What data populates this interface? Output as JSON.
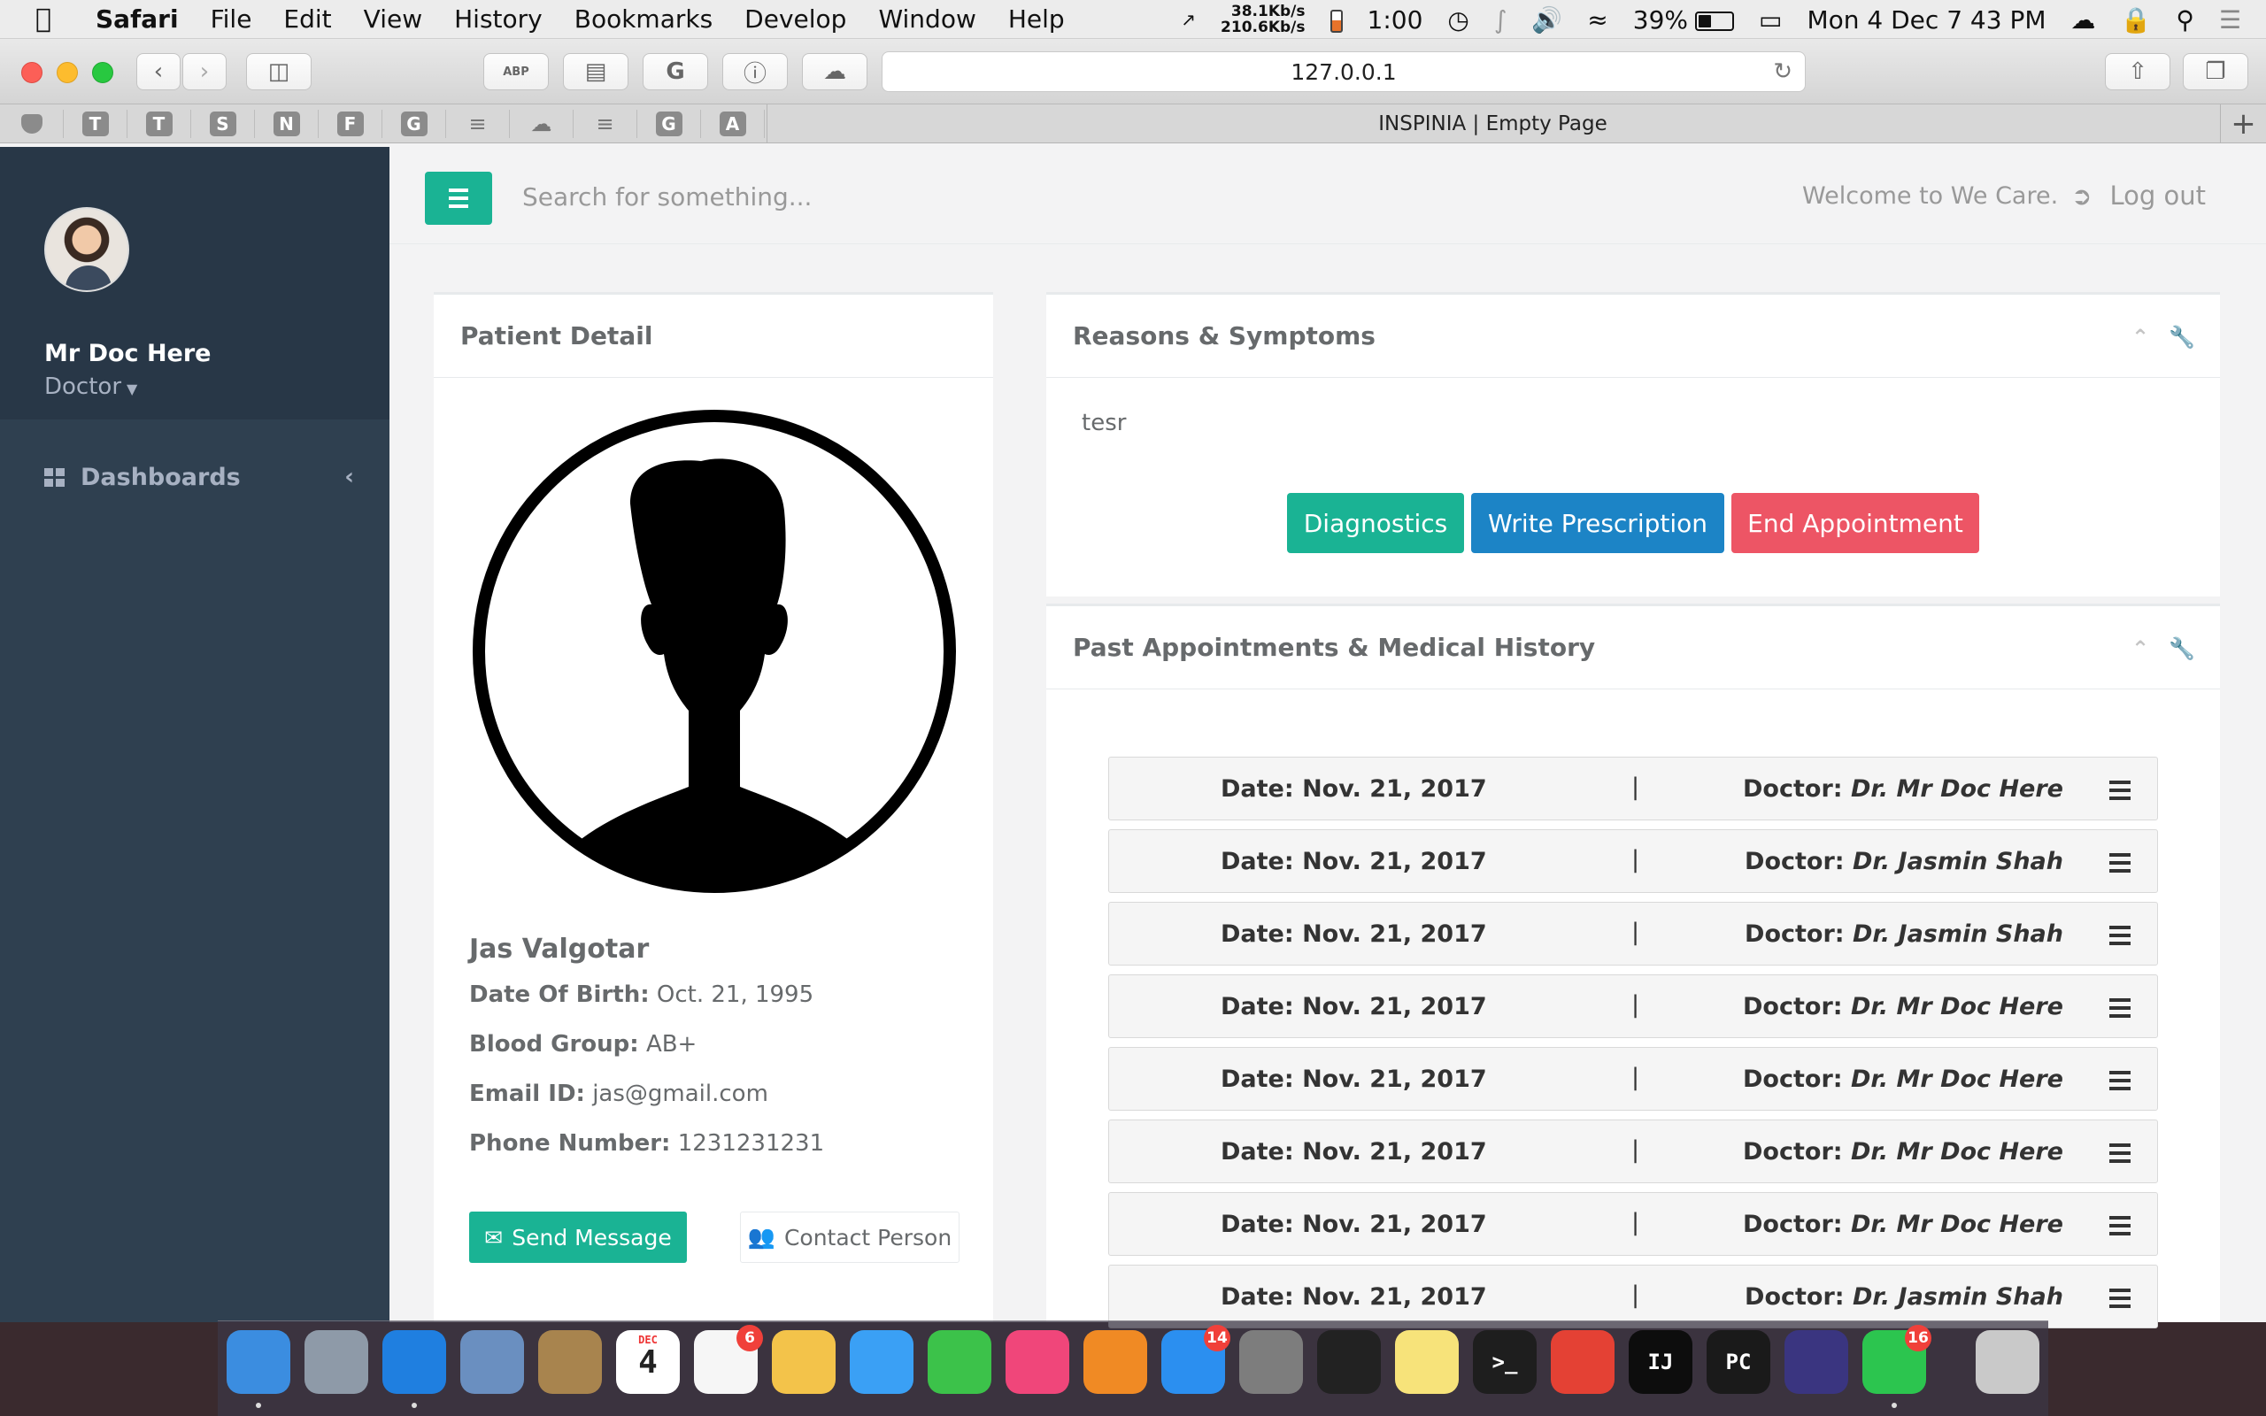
{
  "menubar": {
    "app": "Safari",
    "items": [
      "File",
      "Edit",
      "View",
      "History",
      "Bookmarks",
      "Develop",
      "Window",
      "Help"
    ],
    "net_up": "38.1Kb/s",
    "net_down": "210.6Kb/s",
    "timer": "1:00",
    "battery": "39%",
    "battery_level": 0.39,
    "clock": "Mon 4 Dec  7 43 PM"
  },
  "browser": {
    "url": "127.0.0.1",
    "tab_title": "INSPINIA | Empty Page",
    "favorites": [
      "T",
      "T",
      "S",
      "N",
      "F",
      "G",
      "G",
      "A"
    ]
  },
  "sidebar": {
    "user_name": "Mr Doc Here",
    "user_role": "Doctor",
    "nav": [
      {
        "label": "Dashboards"
      }
    ]
  },
  "topnav": {
    "search_placeholder": "Search for something...",
    "welcome": "Welcome to We Care.",
    "logout": "Log out"
  },
  "patient": {
    "title": "Patient Detail",
    "name": "Jas Valgotar",
    "dob_label": "Date Of Birth:",
    "dob": "Oct. 21, 1995",
    "blood_label": "Blood Group:",
    "blood": "AB+",
    "email_label": "Email ID:",
    "email": "jas@gmail.com",
    "phone_label": "Phone Number:",
    "phone": "1231231231",
    "send_message": "Send Message",
    "contact_person": "Contact Person"
  },
  "reasons": {
    "title": "Reasons & Symptoms",
    "text": "tesr",
    "btn_diagnostics": "Diagnostics",
    "btn_prescription": "Write Prescription",
    "btn_end": "End Appointment"
  },
  "history": {
    "title": "Past Appointments & Medical History",
    "date_label": "Date:",
    "doctor_label": "Doctor:",
    "separator": "|",
    "rows": [
      {
        "date": "Nov. 21, 2017",
        "doctor": "Dr. Mr Doc Here"
      },
      {
        "date": "Nov. 21, 2017",
        "doctor": "Dr. Jasmin Shah"
      },
      {
        "date": "Nov. 21, 2017",
        "doctor": "Dr. Jasmin Shah"
      },
      {
        "date": "Nov. 21, 2017",
        "doctor": "Dr. Mr Doc Here"
      },
      {
        "date": "Nov. 21, 2017",
        "doctor": "Dr. Mr Doc Here"
      },
      {
        "date": "Nov. 21, 2017",
        "doctor": "Dr. Mr Doc Here"
      },
      {
        "date": "Nov. 21, 2017",
        "doctor": "Dr. Mr Doc Here"
      },
      {
        "date": "Nov. 21, 2017",
        "doctor": "Dr. Jasmin Shah"
      }
    ]
  },
  "dock": {
    "apps": [
      {
        "name": "finder-icon",
        "color": "#3b8de0"
      },
      {
        "name": "launchpad-icon",
        "color": "#8e9aa8"
      },
      {
        "name": "safari-icon",
        "color": "#1f7fe0"
      },
      {
        "name": "mail-icon",
        "color": "#6a8fc0"
      },
      {
        "name": "contacts-icon",
        "color": "#a8844e"
      },
      {
        "name": "calendar-icon",
        "color": "#ffffff",
        "text": "4",
        "sub": "DEC"
      },
      {
        "name": "reminders-icon",
        "color": "#f6f6f6",
        "badge": "6"
      },
      {
        "name": "photos-icon",
        "color": "#f3c34a"
      },
      {
        "name": "messages-icon",
        "color": "#3aa0f5"
      },
      {
        "name": "facetime-icon",
        "color": "#3cc24a"
      },
      {
        "name": "itunes-icon",
        "color": "#f0467a"
      },
      {
        "name": "ibooks-icon",
        "color": "#f08a24"
      },
      {
        "name": "app-store-icon",
        "color": "#2b8ff0",
        "badge": "14"
      },
      {
        "name": "system-preferences-icon",
        "color": "#7d7d7d"
      },
      {
        "name": "activity-monitor-icon",
        "color": "#222222"
      },
      {
        "name": "notes-icon",
        "color": "#f7e37a"
      },
      {
        "name": "terminal-icon",
        "color": "#1e1e1e",
        "text": ">_"
      },
      {
        "name": "chrome-icon",
        "color": "#e44134"
      },
      {
        "name": "intellij-icon",
        "color": "#0d0d0d",
        "text": "IJ"
      },
      {
        "name": "pycharm-icon",
        "color": "#1a1a1a",
        "text": "PC"
      },
      {
        "name": "eclipse-icon",
        "color": "#3a3580"
      },
      {
        "name": "whatsapp-icon",
        "color": "#2cc54f",
        "badge": "16"
      },
      {
        "name": "trash-icon",
        "color": "#c9c9c9"
      }
    ]
  },
  "colors": {
    "primary": "#1ab394",
    "info": "#1c84c6",
    "danger": "#ed5565",
    "sidebar": "#2f4050"
  }
}
